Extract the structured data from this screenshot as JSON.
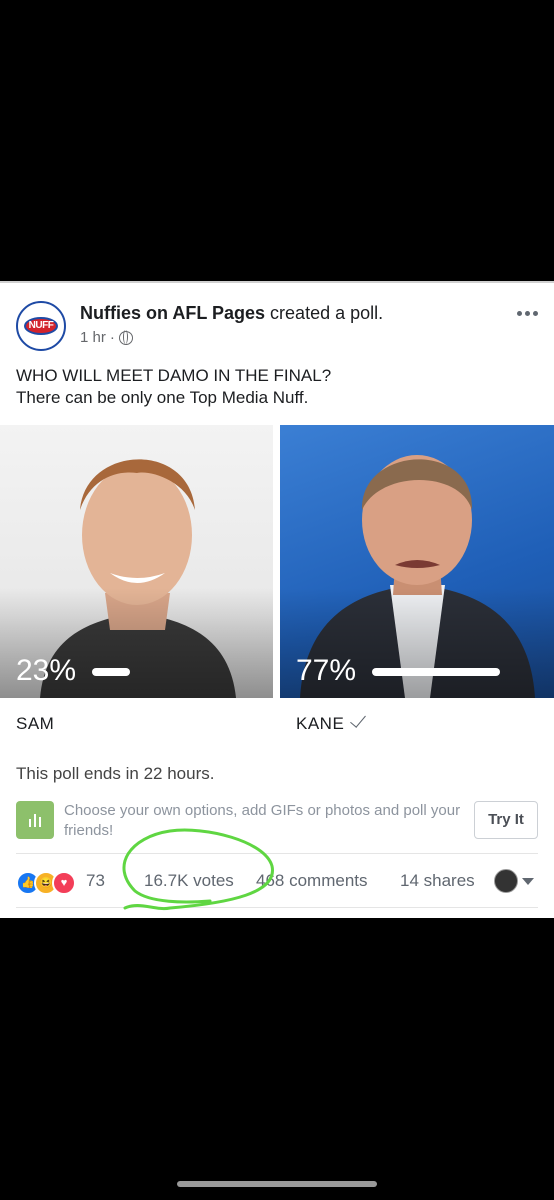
{
  "post": {
    "author": "Nuffies on AFL Pages",
    "action": "created a poll.",
    "avatar_text": "NUFF",
    "time": "1 hr",
    "separator": "·",
    "icon": "globe-icon",
    "question": "WHO WILL MEET DAMO IN THE FINAL?",
    "subtext": "There can be only one Top Media Nuff."
  },
  "poll": {
    "options": [
      {
        "label": "SAM",
        "percent_text": "23%",
        "percent": 23,
        "selected": false
      },
      {
        "label": "KANE",
        "percent_text": "77%",
        "percent": 77,
        "selected": true
      }
    ],
    "ends_text": "This poll ends in 22 hours."
  },
  "promo": {
    "text": "Choose your own options, add GIFs or photos and poll your friends!",
    "button": "Try It",
    "icon": "poll-chart-icon"
  },
  "footer": {
    "reaction_icons": [
      "like-icon",
      "haha-icon",
      "love-icon"
    ],
    "reaction_count": "73",
    "votes": "16.7K votes",
    "comments": "468 comments",
    "shares": "14 shares"
  },
  "colors": {
    "brand_blue": "#1e4aa5",
    "like_blue": "#1877f2",
    "love_red": "#f33e58",
    "haha_yellow": "#f7b125",
    "annotation_green": "#5fd642",
    "promo_green": "#8dc06b"
  }
}
